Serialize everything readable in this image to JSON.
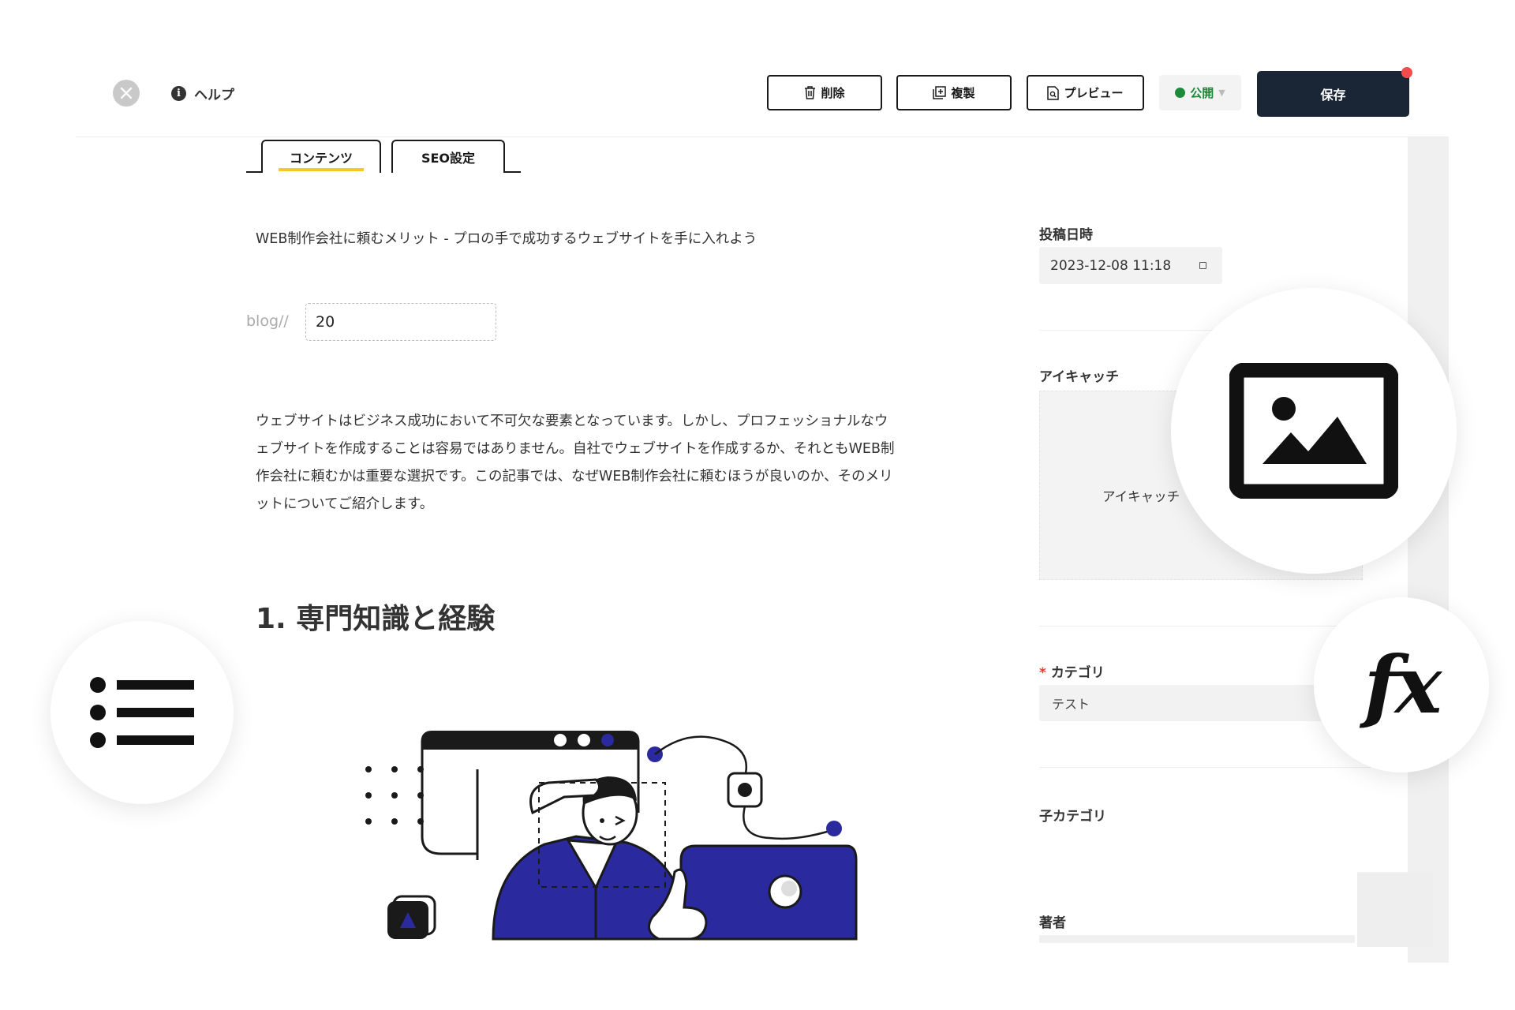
{
  "toolbar": {
    "help_label": "ヘルプ",
    "delete_label": "削除",
    "duplicate_label": "複製",
    "preview_label": "プレビュー",
    "status_label": "公開",
    "save_label": "保存",
    "colors": {
      "primary": "#1a2535",
      "status_green": "#1d8a39",
      "notify": "#f14d4d",
      "tab_accent": "#f3c92b"
    }
  },
  "tabs": [
    {
      "label": "コンテンツ",
      "active": true
    },
    {
      "label": "SEO設定",
      "active": false
    }
  ],
  "editor": {
    "title": "WEB制作会社に頼むメリット - プロの手で成功するウェブサイトを手に入れよう",
    "slug_prefix": "blog//",
    "slug_value": "20",
    "body_lines": [
      "ウェブサイトはビジネス成功において不可欠な要素となっています。しかし、プロフェッショナルなウ",
      "ェブサイトを作成することは容易ではありません。自社でウェブサイトを作成するか、それともWEB制",
      "作会社に頼むかは重要な選択です。この記事では、なぜWEB制作会社に頼むほうが良いのか、そのメリ",
      "ットについてご紹介します。"
    ],
    "heading": "1. 専門知識と経験",
    "illustration_icon": "person-framing-illustration"
  },
  "sidebar": {
    "post_date_label": "投稿日時",
    "post_date_value": "2023-12-08 11:18",
    "eyecatch_label": "アイキャッチ",
    "eyecatch_placeholder": "アイキャッチ",
    "category_required": "*",
    "category_label": "カテゴリ",
    "category_value": "テスト",
    "subcategory_label": "子カテゴリ",
    "author_label": "著者"
  },
  "badges": {
    "image_badge_icon": "image-icon",
    "function_badge_icon": "function-icon",
    "function_text": "fx",
    "list_badge_icon": "list-icon"
  }
}
